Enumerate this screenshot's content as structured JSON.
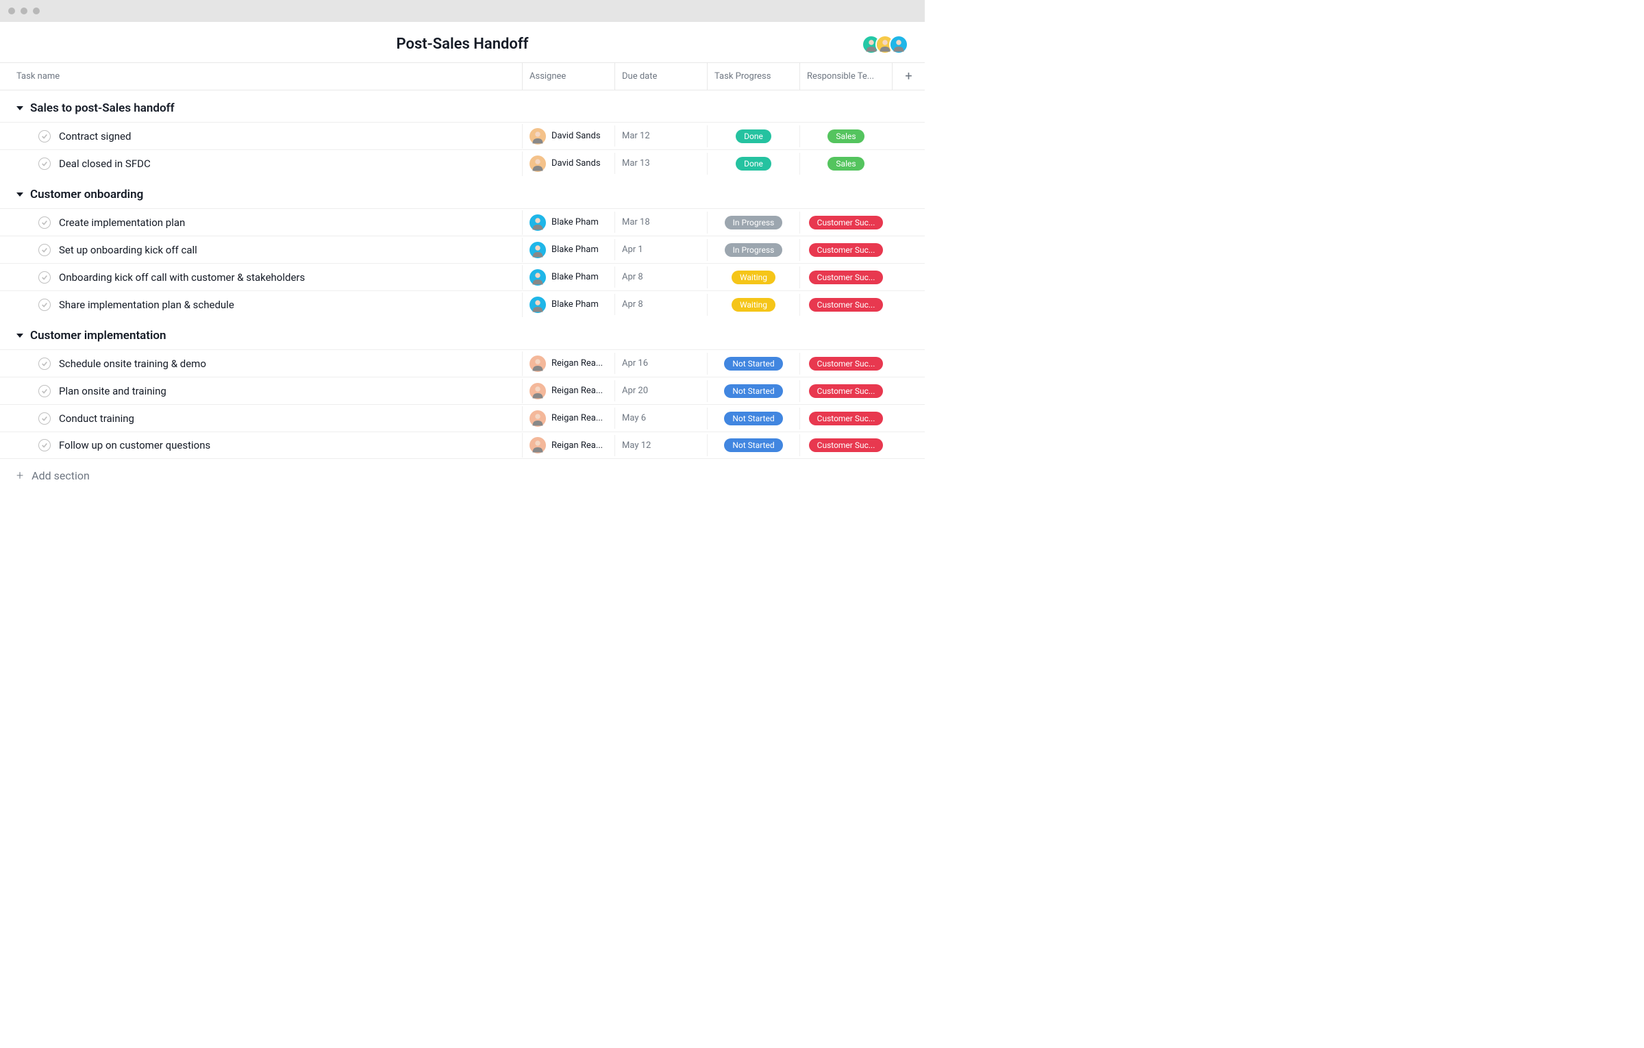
{
  "title": "Post-Sales Handoff",
  "columns": {
    "task": "Task name",
    "assignee": "Assignee",
    "due": "Due date",
    "progress": "Task Progress",
    "team": "Responsible Te..."
  },
  "add_section_label": "Add section",
  "members": [
    {
      "bg": "#24c8a6"
    },
    {
      "bg": "#f7c948"
    },
    {
      "bg": "#1fb6e8"
    }
  ],
  "pill_colors": {
    "Done": "#25c2a0",
    "In Progress": "#9ca6af",
    "Waiting": "#f5c518",
    "Not Started": "#4186e0",
    "Sales": "#54c45e",
    "Customer Suc...": "#e8384f"
  },
  "assignee_colors": {
    "David Sands": "#f4c28a",
    "Blake Pham": "#1fb6e8",
    "Reigan Rea...": "#f4b89a"
  },
  "sections": [
    {
      "title": "Sales to post-Sales handoff",
      "tasks": [
        {
          "name": "Contract signed",
          "assignee": "David Sands",
          "due": "Mar 12",
          "progress": "Done",
          "team": "Sales"
        },
        {
          "name": "Deal closed in SFDC",
          "assignee": "David Sands",
          "due": "Mar 13",
          "progress": "Done",
          "team": "Sales"
        }
      ]
    },
    {
      "title": "Customer onboarding",
      "tasks": [
        {
          "name": "Create implementation plan",
          "assignee": "Blake Pham",
          "due": "Mar 18",
          "progress": "In Progress",
          "team": "Customer Suc..."
        },
        {
          "name": "Set up onboarding kick off call",
          "assignee": "Blake Pham",
          "due": "Apr 1",
          "progress": "In Progress",
          "team": "Customer Suc..."
        },
        {
          "name": "Onboarding kick off call with customer & stakeholders",
          "assignee": "Blake Pham",
          "due": "Apr 8",
          "progress": "Waiting",
          "team": "Customer Suc..."
        },
        {
          "name": "Share implementation plan & schedule",
          "assignee": "Blake Pham",
          "due": "Apr 8",
          "progress": "Waiting",
          "team": "Customer Suc..."
        }
      ]
    },
    {
      "title": "Customer implementation",
      "tasks": [
        {
          "name": "Schedule onsite training & demo",
          "assignee": "Reigan Rea...",
          "due": "Apr 16",
          "progress": "Not Started",
          "team": "Customer Suc..."
        },
        {
          "name": "Plan onsite and training",
          "assignee": "Reigan Rea...",
          "due": "Apr 20",
          "progress": "Not Started",
          "team": "Customer Suc..."
        },
        {
          "name": "Conduct training",
          "assignee": "Reigan Rea...",
          "due": "May 6",
          "progress": "Not Started",
          "team": "Customer Suc..."
        },
        {
          "name": "Follow up on customer questions",
          "assignee": "Reigan Rea...",
          "due": "May 12",
          "progress": "Not Started",
          "team": "Customer Suc..."
        }
      ]
    }
  ]
}
